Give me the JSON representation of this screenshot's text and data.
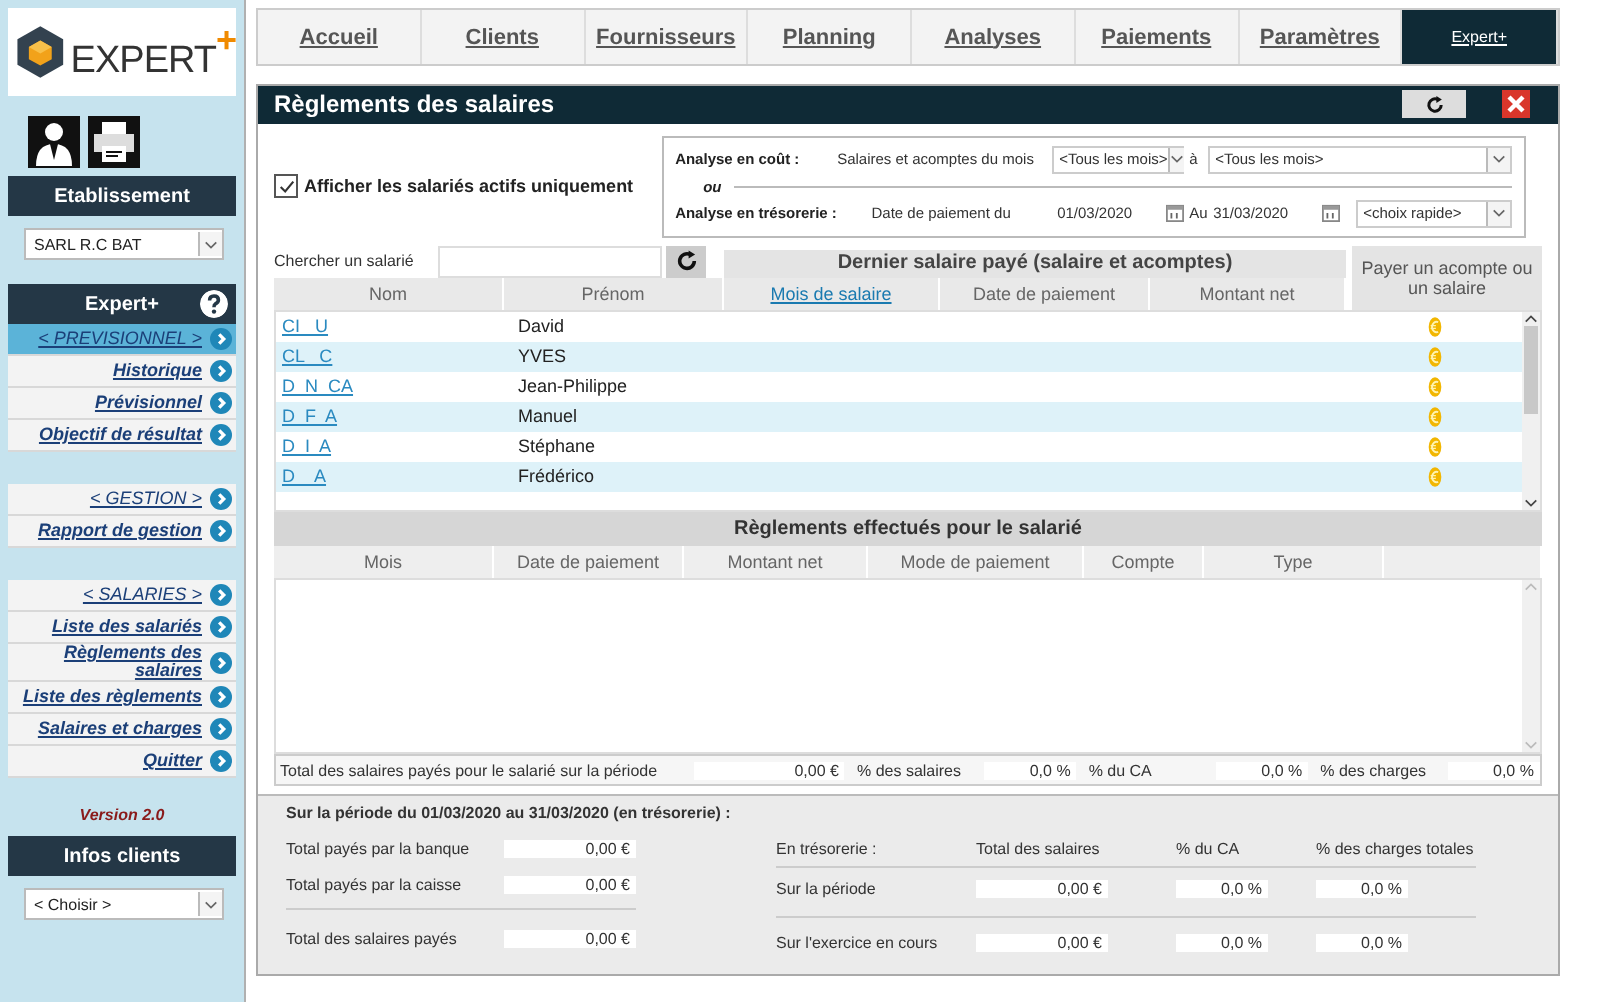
{
  "logo": {
    "text": "EXPERT",
    "sup": "+"
  },
  "nav": [
    {
      "label": "Accueil",
      "selected": false
    },
    {
      "label": "Clients",
      "selected": false
    },
    {
      "label": "Fournisseurs",
      "selected": false
    },
    {
      "label": "Planning",
      "selected": false
    },
    {
      "label": "Analyses",
      "selected": false
    },
    {
      "label": "Paiements",
      "selected": false
    },
    {
      "label": "Paramètres",
      "selected": false
    },
    {
      "label": "Expert+",
      "selected": true
    }
  ],
  "sidebar": {
    "establishment_heading": "Etablissement",
    "establishment_select": "SARL R.C BAT",
    "expert_heading": "Expert+",
    "menu_groups": [
      [
        {
          "label": "< PREVISIONNEL >",
          "kind": "group",
          "selected": true
        },
        {
          "label": "Historique",
          "kind": "link",
          "selected": false
        },
        {
          "label": "Prévisionnel",
          "kind": "link",
          "selected": false
        },
        {
          "label": "Objectif de résultat",
          "kind": "link",
          "selected": false
        }
      ],
      [
        {
          "label": "< GESTION >",
          "kind": "group",
          "selected": false
        },
        {
          "label": "Rapport de gestion",
          "kind": "link",
          "selected": false
        }
      ],
      [
        {
          "label": "< SALARIES >",
          "kind": "group",
          "selected": false
        },
        {
          "label": "Liste des salariés",
          "kind": "link",
          "selected": false
        },
        {
          "label": "Règlements des salaires",
          "kind": "link",
          "selected": false
        },
        {
          "label": "Liste des règlements",
          "kind": "link",
          "selected": false
        },
        {
          "label": "Salaires et charges",
          "kind": "link",
          "selected": false
        },
        {
          "label": "Quitter",
          "kind": "link",
          "selected": false
        }
      ]
    ],
    "version": "Version 2.0",
    "clients_heading": "Infos clients",
    "clients_select": "< Choisir >"
  },
  "panel": {
    "title": "Règlements des salaires"
  },
  "filters": {
    "active_only": {
      "label": "Afficher les salariés actifs uniquement",
      "checked": true
    },
    "cost": {
      "label": "Analyse en coût :",
      "description": "Salaires et acomptes du mois",
      "from": "<Tous les mois>",
      "separator": "à",
      "to": "<Tous les mois>"
    },
    "or": "ou",
    "treasury": {
      "label": "Analyse en trésorerie :",
      "description": "Date de paiement du",
      "from": "01/03/2020",
      "separator": "Au",
      "to": "31/03/2020",
      "quick": "<choix rapide>"
    }
  },
  "search": {
    "label": "Chercher un salarié"
  },
  "employees": {
    "group_heading": "Dernier salaire payé (salaire et acomptes)",
    "pay_heading": "Payer un acompte ou un salaire",
    "columns": [
      "Nom",
      "Prénom",
      "Mois de salaire",
      "Date de paiement",
      "Montant net"
    ],
    "rows": [
      {
        "nom": "CI   U",
        "prenom": "David"
      },
      {
        "nom": "CL   C",
        "prenom": "YVES"
      },
      {
        "nom": "D  N  CA",
        "prenom": "Jean-Philippe"
      },
      {
        "nom": "D  F  A",
        "prenom": "Manuel"
      },
      {
        "nom": "D  I  A",
        "prenom": "Stéphane"
      },
      {
        "nom": "D    A",
        "prenom": "Frédérico"
      }
    ]
  },
  "payments": {
    "heading": "Règlements effectués pour le salarié",
    "columns": [
      "Mois",
      "Date de paiement",
      "Montant net",
      "Mode de paiement",
      "Compte",
      "Type"
    ],
    "total": {
      "label": "Total des salaires payés pour le salarié sur la période",
      "value": "0,00 €",
      "ratios": [
        {
          "label": "% des salaires",
          "value": "0,0 %"
        },
        {
          "label": "% du CA",
          "value": "0,0 %"
        },
        {
          "label": "% des charges",
          "value": "0,0 %"
        }
      ]
    }
  },
  "summary": {
    "title": "Sur la période du 01/03/2020 au 31/03/2020 (en trésorerie) :",
    "left": [
      {
        "label": "Total payés par la banque",
        "value": "0,00 €"
      },
      {
        "label": "Total payés par la caisse",
        "value": "0,00 €"
      },
      {
        "label": "Total des salaires payés",
        "value": "0,00 €"
      }
    ],
    "columns": [
      "En trésorerie :",
      "Total des salaires",
      "% du CA",
      "% des charges totales"
    ],
    "rows": [
      {
        "label": "Sur la période",
        "values": [
          "0,00 €",
          "0,0 %",
          "0,0 %"
        ]
      },
      {
        "label": "Sur l'exercice en cours",
        "values": [
          "0,00 €",
          "0,0 %",
          "0,0 %"
        ]
      }
    ]
  }
}
